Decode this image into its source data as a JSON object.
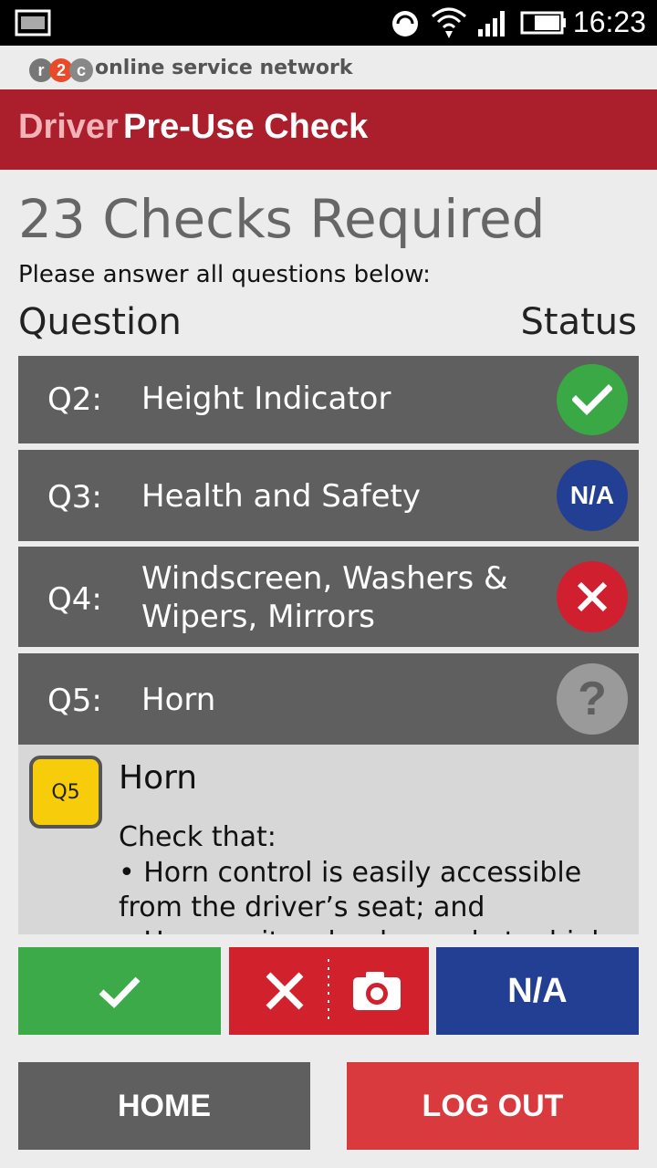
{
  "status_bar": {
    "time": "16:23"
  },
  "brand": {
    "logo_text": "r2c",
    "tagline": "online service network"
  },
  "header": {
    "logo_word": "Driver",
    "title": "Pre-Use Check"
  },
  "page": {
    "checks_title": "23 Checks Required",
    "instructions": "Please answer all questions below:",
    "column_question": "Question",
    "column_status": "Status"
  },
  "questions": [
    {
      "num": "Q2:",
      "text": "Height Indicator",
      "status": "pass",
      "status_icon": "check-icon",
      "status_color": "#3aa845"
    },
    {
      "num": "Q3:",
      "text": "Health and Safety",
      "status": "na",
      "status_label": "N/A",
      "status_color": "#233f94"
    },
    {
      "num": "Q4:",
      "text_line1": "Windscreen, Washers &",
      "text_line2": "Wipers, Mirrors",
      "status": "fail",
      "status_icon": "cross-icon",
      "status_color": "#d02030"
    },
    {
      "num": "Q5:",
      "text": "Horn",
      "status": "unanswered",
      "status_label": "?",
      "status_color": "#9a9a9a"
    }
  ],
  "detail": {
    "badge": "Q5",
    "title": "Horn",
    "check_that": "Check that:",
    "line1": "• Horn control is easily accessible from the driver’s seat; and",
    "line2": "• Horn emits a loud sound at a high"
  },
  "actions": {
    "pass_icon": "check-icon",
    "fail_icon": "cross-icon",
    "camera_icon": "camera-icon",
    "na_label": "N/A",
    "pass_color": "#3daa4a",
    "fail_color": "#d0212d",
    "na_color": "#233f94"
  },
  "nav": {
    "home_label": "HOME",
    "logout_label": "LOG OUT",
    "home_color": "#5f5f5f",
    "logout_color": "#d93a3e"
  }
}
